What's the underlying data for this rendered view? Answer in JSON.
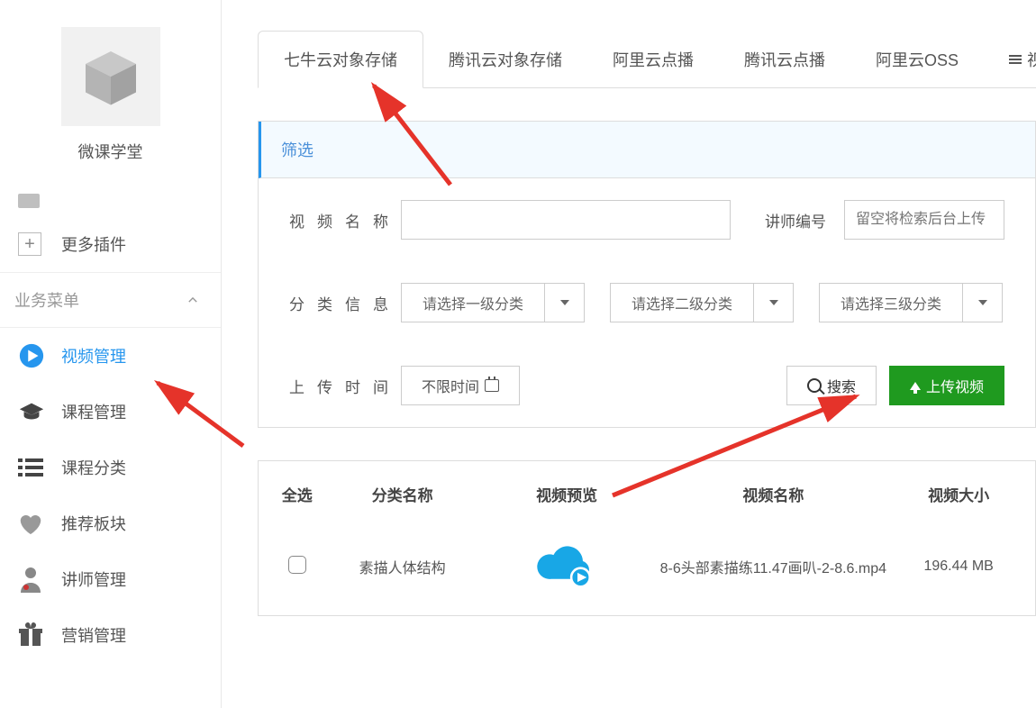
{
  "brand": "微课学堂",
  "sidebar": {
    "more_plugins": "更多插件",
    "menu_header": "业务菜单",
    "items": [
      {
        "label": "视频管理",
        "icon": "play-circle-icon",
        "active": true
      },
      {
        "label": "课程管理",
        "icon": "graduation-cap-icon"
      },
      {
        "label": "课程分类",
        "icon": "list-icon"
      },
      {
        "label": "推荐板块",
        "icon": "heart-icon"
      },
      {
        "label": "讲师管理",
        "icon": "doctor-icon"
      },
      {
        "label": "营销管理",
        "icon": "gift-icon"
      }
    ]
  },
  "tabs": [
    "七牛云对象存储",
    "腾讯云对象存储",
    "阿里云点播",
    "腾讯云点播",
    "阿里云OSS",
    "视"
  ],
  "filter": {
    "header": "筛选",
    "video_name_label": "视频名称",
    "teacher_no_label": "讲师编号",
    "teacher_no_placeholder": "留空将检索后台上传",
    "category_label": "分类信息",
    "cat1": "请选择一级分类",
    "cat2": "请选择二级分类",
    "cat3": "请选择三级分类",
    "upload_time_label": "上传时间",
    "upload_time_value": "不限时间",
    "search_btn": "搜索",
    "upload_btn": "上传视频"
  },
  "table": {
    "headers": {
      "select": "全选",
      "category": "分类名称",
      "preview": "视频预览",
      "name": "视频名称",
      "size": "视频大小"
    },
    "rows": [
      {
        "category": "素描人体结构",
        "name": "8-6头部素描练11.47画叭-2-8.6.mp4",
        "size": "196.44 MB"
      }
    ]
  }
}
